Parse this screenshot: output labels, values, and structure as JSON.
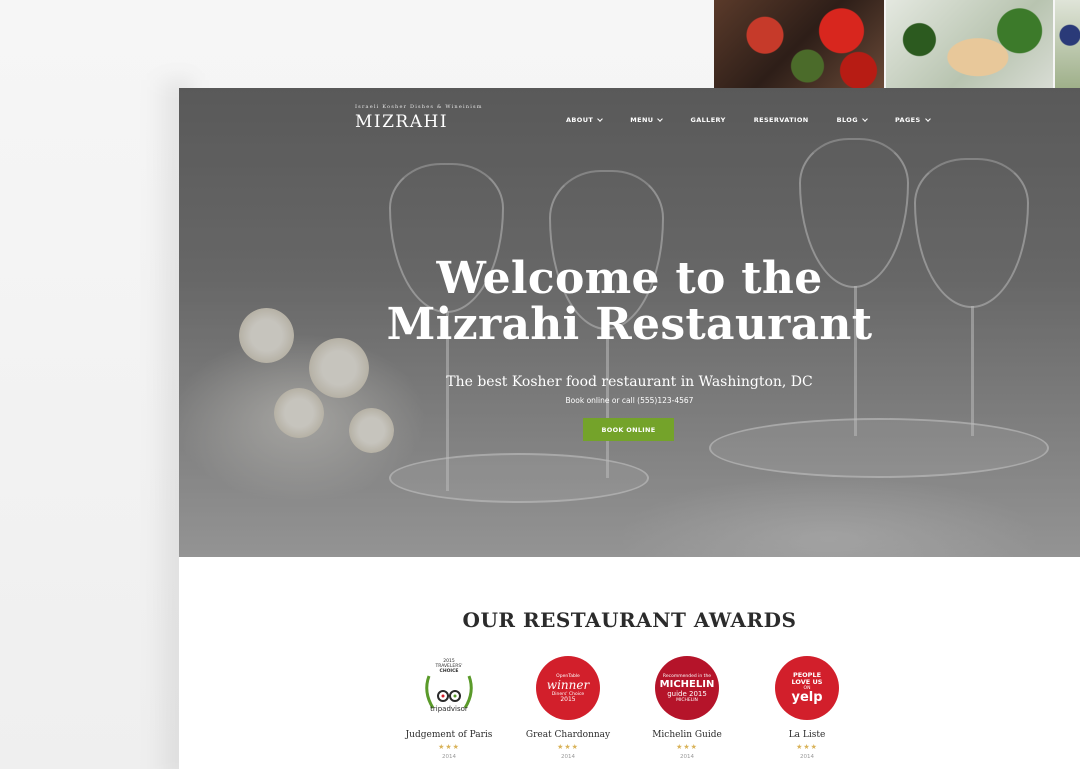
{
  "brand": {
    "tagline": "Israeli Kosher Dishes & Wineinism",
    "name": "MIZRAHI"
  },
  "nav": {
    "items": [
      {
        "label": "ABOUT",
        "has_dropdown": true
      },
      {
        "label": "MENU",
        "has_dropdown": true
      },
      {
        "label": "GALLERY",
        "has_dropdown": false
      },
      {
        "label": "RESERVATION",
        "has_dropdown": false
      },
      {
        "label": "BLOG",
        "has_dropdown": true
      },
      {
        "label": "PAGES",
        "has_dropdown": true
      }
    ]
  },
  "hero": {
    "title_line1": "Welcome to the",
    "title_line2": "Mizrahi Restaurant",
    "subtitle": "The best Kosher food restaurant in Washington, DC",
    "call_text": "Book online or call (555)123-4567",
    "button_label": "BOOK ONLINE"
  },
  "awards": {
    "title": "OUR RESTAURANT AWARDS",
    "items": [
      {
        "name": "Judgement of Paris",
        "stars": "★★★",
        "year": "2014",
        "badge": {
          "line1": "2015",
          "line2": "TRAVELERS'",
          "line3": "CHOICE",
          "line4": "tripadvisor"
        }
      },
      {
        "name": "Great Chardonnay",
        "stars": "★★★",
        "year": "2014",
        "badge": {
          "line1": "OpenTable",
          "line2": "winner",
          "line3": "Diners' Choice",
          "line4": "2015"
        }
      },
      {
        "name": "Michelin Guide",
        "stars": "★★★",
        "year": "2014",
        "badge": {
          "line1": "Recommended in the",
          "line2": "MICHELIN",
          "line3": "guide 2015",
          "line4": "MICHELIN"
        }
      },
      {
        "name": "La Liste",
        "stars": "★★★",
        "year": "2014",
        "badge": {
          "line1": "PEOPLE",
          "line2": "LOVE US",
          "line3": "ON",
          "line4": "yelp"
        }
      }
    ]
  },
  "colors": {
    "accent_green": "#74a32a",
    "badge_red": "#d21f2b",
    "star_gold": "#d9b35a"
  }
}
